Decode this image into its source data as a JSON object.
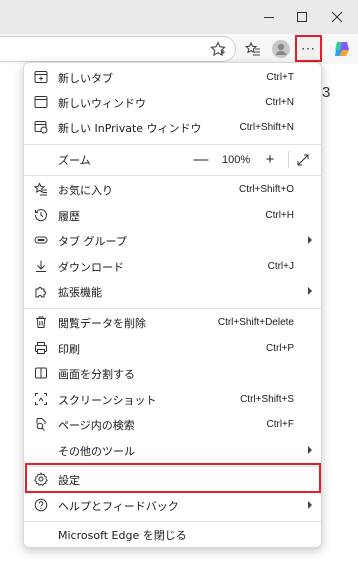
{
  "window": {
    "controls": {
      "minimize": "minimize-icon",
      "maximize": "maximize-icon",
      "close": "close-icon"
    }
  },
  "toolbar": {
    "icons": [
      "favorite-star-icon",
      "favorites-icon",
      "profile-icon",
      "more-icon",
      "copilot-icon"
    ],
    "more_label": "···"
  },
  "page": {
    "partial_text": "3"
  },
  "menu": {
    "items": [
      {
        "label": "新しいタブ",
        "shortcut": "Ctrl+T",
        "icon": "new-tab-icon"
      },
      {
        "label": "新しいウィンドウ",
        "shortcut": "Ctrl+N",
        "icon": "new-window-icon"
      },
      {
        "label": "新しい InPrivate ウィンドウ",
        "shortcut": "Ctrl+Shift+N",
        "icon": "inprivate-icon"
      }
    ],
    "zoom": {
      "label": "ズーム",
      "minus": "—",
      "value": "100%",
      "plus": "+",
      "icon": "fullscreen-icon"
    },
    "items2": [
      {
        "label": "お気に入り",
        "shortcut": "Ctrl+Shift+O",
        "icon": "favorites-icon"
      },
      {
        "label": "履歴",
        "shortcut": "Ctrl+H",
        "icon": "history-icon"
      },
      {
        "label": "タブ グループ",
        "shortcut": "",
        "icon": "tab-groups-icon",
        "submenu": true
      },
      {
        "label": "ダウンロード",
        "shortcut": "Ctrl+J",
        "icon": "download-icon"
      },
      {
        "label": "拡張機能",
        "shortcut": "",
        "icon": "extensions-icon",
        "submenu": true
      }
    ],
    "items3": [
      {
        "label": "閲覧データを削除",
        "shortcut": "Ctrl+Shift+Delete",
        "icon": "trash-icon"
      },
      {
        "label": "印刷",
        "shortcut": "Ctrl+P",
        "icon": "print-icon"
      },
      {
        "label": "画面を分割する",
        "shortcut": "",
        "icon": "split-screen-icon"
      },
      {
        "label": "スクリーンショット",
        "shortcut": "Ctrl+Shift+S",
        "icon": "screenshot-icon"
      },
      {
        "label": "ページ内の検索",
        "shortcut": "Ctrl+F",
        "icon": "find-icon"
      },
      {
        "label": "その他のツール",
        "shortcut": "",
        "icon": "",
        "submenu": true
      }
    ],
    "items4": [
      {
        "label": "設定",
        "shortcut": "",
        "icon": "gear-icon"
      },
      {
        "label": "ヘルプとフィードバック",
        "shortcut": "",
        "icon": "help-icon",
        "submenu": true
      }
    ],
    "close": {
      "label": "Microsoft Edge を閉じる"
    }
  },
  "colors": {
    "highlight": "#e0202a",
    "copilot": "#7b5cff"
  }
}
